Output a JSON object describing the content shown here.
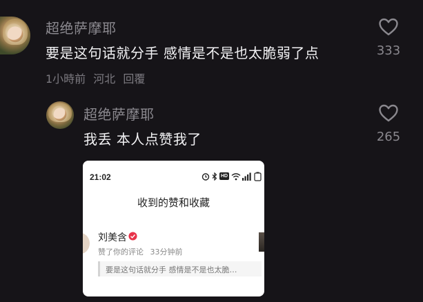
{
  "comments": [
    {
      "username": "超绝萨摩耶",
      "text": "要是这句话就分手 感情是不是也太脆弱了点",
      "time": "1小時前",
      "location": "河北",
      "reply_label": "回覆",
      "likes": "333"
    },
    {
      "username": "超绝萨摩耶",
      "text": "我丢 本人点赞我了",
      "likes": "265"
    }
  ],
  "screenshot": {
    "status_time": "21:02",
    "status_icons": [
      "alarm-icon",
      "bluetooth-icon",
      "hd-icon",
      "wifi-icon",
      "signal-icon",
      "battery-icon"
    ],
    "hd_label": "HD",
    "title": "收到的赞和收藏",
    "user_name": "刘美含",
    "action": "赞了你的评论",
    "time_ago": "33分钟前",
    "quoted_comment": "要是这句话就分手 感情是不是也太脆…",
    "verified_color": "#e8334a"
  },
  "colors": {
    "background": "#161418",
    "username": "#8c8a90",
    "text": "#f2f2f4"
  }
}
